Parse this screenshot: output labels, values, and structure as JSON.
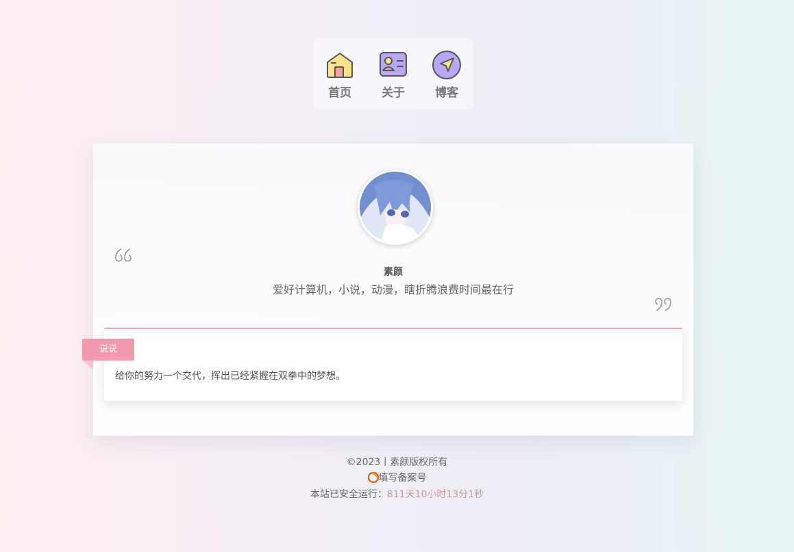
{
  "nav": {
    "items": [
      {
        "label": "首页",
        "icon": "home-icon"
      },
      {
        "label": "关于",
        "icon": "id-card-icon"
      },
      {
        "label": "博客",
        "icon": "navigation-icon"
      }
    ]
  },
  "profile": {
    "name": "素颜",
    "motto": "爱好计算机，小说，动漫，瞎折腾浪费时间最在行",
    "avatar": "anime-avatar"
  },
  "talk": {
    "tag": "说说",
    "text": "给你的努力一个交代，挥出已经紧握在双拳中的梦想。"
  },
  "footer": {
    "copyright": "©2023丨素颜版权所有",
    "beian": "填写备案号",
    "uptime_label": "本站已安全运行：",
    "uptime_value": "811天10小时13分1秒"
  },
  "colors": {
    "accent_pink": "#f49aae",
    "uptime": "#c99a9a"
  }
}
